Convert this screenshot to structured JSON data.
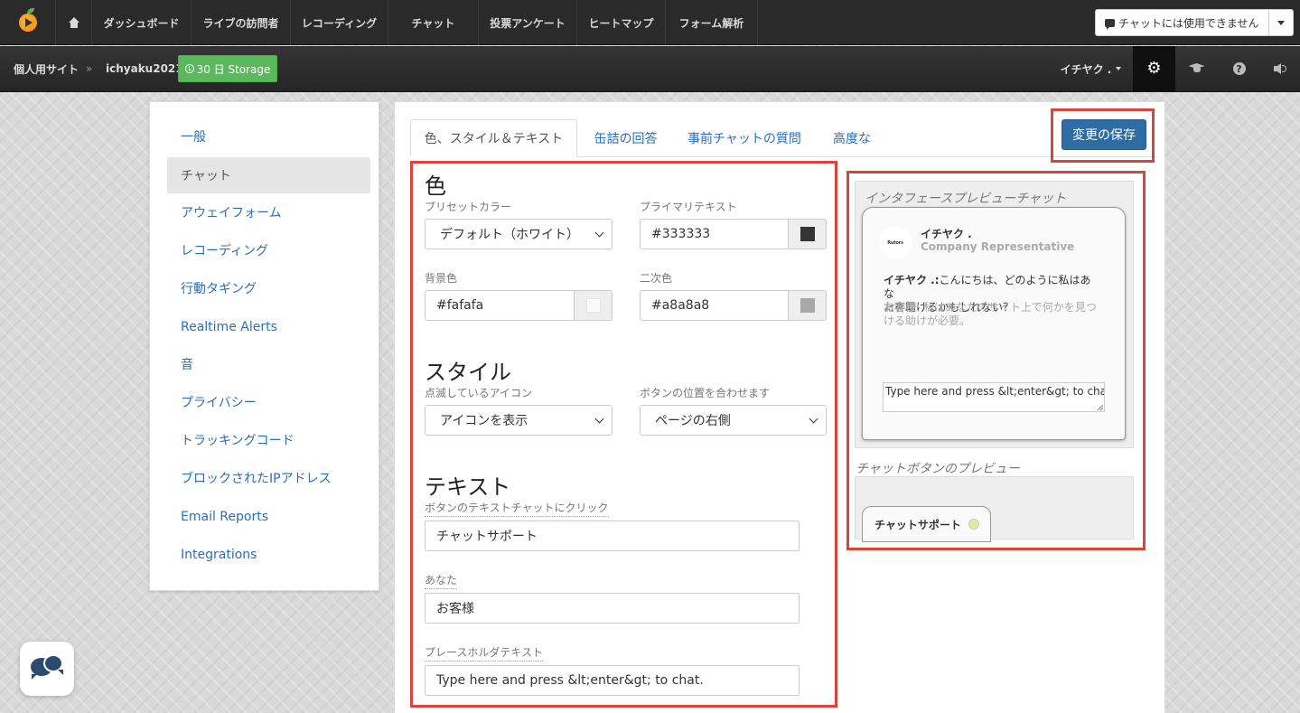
{
  "topnav": {
    "tabs": [
      "ダッシュボード",
      "ライブの訪問者",
      "レコーディング",
      "チャット",
      "投票アンケート",
      "ヒートマップ",
      "フォーム解析"
    ],
    "chat_status": "チャットには使用できません"
  },
  "subbar": {
    "site": "個人用サイト",
    "separator": "»",
    "account": "ichyaku2021",
    "storage": "30 日 Storage",
    "user": "イチヤク ."
  },
  "sidebar": {
    "items": [
      "一般",
      "チャット",
      "アウェイフォーム",
      "レコーディング",
      "行動タギング",
      "Realtime Alerts",
      "音",
      "プライバシー",
      "トラッキングコード",
      "ブロックされたIPアドレス",
      "Email Reports",
      "Integrations"
    ],
    "active_index": 1
  },
  "tabs": [
    "色、スタイル＆テキスト",
    "缶詰の回答",
    "事前チャットの質問",
    "高度な"
  ],
  "save_label": "変更の保存",
  "colors": {
    "title": "色",
    "preset_label": "プリセットカラー",
    "preset_value": "デフォルト（ホワイト）",
    "primary_text_label": "プライマリテキスト",
    "primary_text_value": "#333333",
    "background_label": "背景色",
    "background_value": "#fafafa",
    "secondary_label": "二次色",
    "secondary_value": "#a8a8a8"
  },
  "style": {
    "title": "スタイル",
    "blink_label": "点滅しているアイコン",
    "blink_value": "アイコンを表示",
    "position_label": "ボタンの位置を合わせます",
    "position_value": "ページの右側"
  },
  "text": {
    "title": "テキスト",
    "button_text_label": "ボタンのテキストチャットにクリック",
    "button_text_value": "チャットサポート",
    "you_label": "あなた",
    "you_value": "お客様",
    "placeholder_label": "プレースホルダテキスト",
    "placeholder_value": "Type here and press &lt;enter&gt; to chat."
  },
  "preview": {
    "title": "インタフェースプレビューチャット",
    "avatar_text": "Rutors",
    "agent_name": "イチヤク .",
    "agent_role": "Company Representative",
    "agent_msg_name": "イチヤク .:",
    "agent_msg_line1": "こんにちは、どのように私はあな",
    "agent_msg_line2": "たを助けるかもしれない？",
    "customer_msg_name": "お客様",
    "customer_msg_line1": ": 私はあなたのサイト上で何かを見つ",
    "customer_msg_line2": "ける助けが必要。",
    "input_text": "Type here and press &lt;enter&gt; to chat.",
    "button_preview_title": "チャットボタンのプレビュー",
    "button_label": "チャットサポート"
  }
}
